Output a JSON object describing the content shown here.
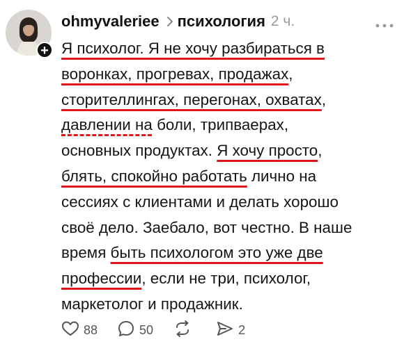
{
  "post": {
    "username": "ohmyvaleriee",
    "topic": "психология",
    "time": "2 ч.",
    "lines": [
      [
        {
          "t": "Я психолог. Я не хочу разбираться в",
          "u": "solid"
        }
      ],
      [
        {
          "t": "воронках, прогревах, продажах",
          "u": "solid"
        },
        {
          "t": ","
        }
      ],
      [
        {
          "t": "сторителлингах, перегонах, охватах",
          "u": "solid"
        },
        {
          "t": ","
        }
      ],
      [
        {
          "t": "давлении на",
          "u": "dashed"
        },
        {
          "t": " боли, трипваерах,"
        }
      ],
      [
        {
          "t": "основных продуктах. "
        },
        {
          "t": "Я хочу просто",
          "u": "solid"
        },
        {
          "t": ","
        }
      ],
      [
        {
          "t": "блять, спокойно работать",
          "u": "solid"
        },
        {
          "t": " лично на"
        }
      ],
      [
        {
          "t": "сессиях с клиентами и делать хорошо"
        }
      ],
      [
        {
          "t": "своё дело. Заебало, вот честно. В наше"
        }
      ],
      [
        {
          "t": "время "
        },
        {
          "t": "быть психологом это уже две",
          "u": "solid"
        }
      ],
      [
        {
          "t": "профессии",
          "u": "solid"
        },
        {
          "t": ", если не три, психолог,"
        }
      ],
      [
        {
          "t": "маркетолог и продажник."
        }
      ]
    ]
  },
  "actions": {
    "likes": "88",
    "comments": "50",
    "shares": "2"
  },
  "icons": {
    "follow": "plus-icon",
    "breadcrumb": "chevron-right-icon",
    "menu": "more-dots-icon",
    "like": "heart-icon",
    "comment": "comment-bubble-icon",
    "repost": "repost-icon",
    "share": "send-icon"
  },
  "colors": {
    "underline": "#e0161b",
    "muted": "#9a9a9a"
  }
}
